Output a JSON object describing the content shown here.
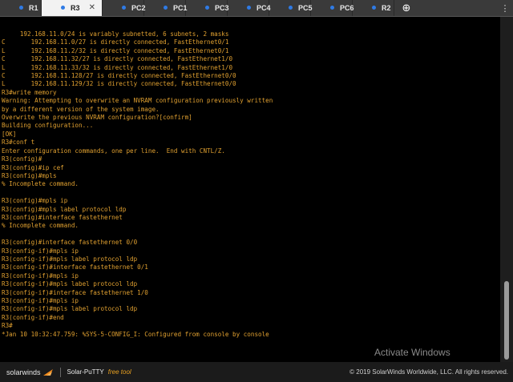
{
  "tabs": [
    {
      "label": "R1",
      "active": false
    },
    {
      "label": "R3",
      "active": true
    },
    {
      "label": "PC2",
      "active": false
    },
    {
      "label": "PC1",
      "active": false
    },
    {
      "label": "PC3",
      "active": false
    },
    {
      "label": "PC4",
      "active": false
    },
    {
      "label": "PC5",
      "active": false
    },
    {
      "label": "PC6",
      "active": false
    },
    {
      "label": "R2",
      "active": false
    }
  ],
  "tab_close_glyph": "✕",
  "new_tab_glyph": "⊕",
  "menu_glyph": "⋮",
  "terminal_lines": [
    "     192.168.11.0/24 is variably subnetted, 6 subnets, 2 masks",
    "C       192.168.11.0/27 is directly connected, FastEthernet0/1",
    "L       192.168.11.2/32 is directly connected, FastEthernet0/1",
    "C       192.168.11.32/27 is directly connected, FastEthernet1/0",
    "L       192.168.11.33/32 is directly connected, FastEthernet1/0",
    "C       192.168.11.128/27 is directly connected, FastEthernet0/0",
    "L       192.168.11.129/32 is directly connected, FastEthernet0/0",
    "R3#write memory",
    "Warning: Attempting to overwrite an NVRAM configuration previously written",
    "by a different version of the system image.",
    "Overwrite the previous NVRAM configuration?[confirm]",
    "Building configuration...",
    "[OK]",
    "R3#conf t",
    "Enter configuration commands, one per line.  End with CNTL/Z.",
    "R3(config)#",
    "R3(config)#ip cef",
    "R3(config)#mpls",
    "% Incomplete command.",
    "",
    "R3(config)#mpls ip",
    "R3(config)#mpls label protocol ldp",
    "R3(config)#interface fastethernet",
    "% Incomplete command.",
    "",
    "R3(config)#interface fastethernet 0/0",
    "R3(config-if)#mpls ip",
    "R3(config-if)#mpls label protocol ldp",
    "R3(config-if)#interface fastethernet 0/1",
    "R3(config-if)#mpls ip",
    "R3(config-if)#mpls label protocol ldp",
    "R3(config-if)#interface fastethernet 1/0",
    "R3(config-if)#mpls ip",
    "R3(config-if)#mpls label protocol ldp",
    "R3(config-if)#end",
    "R3#",
    "*Jan 10 10:32:47.759: %SYS-5-CONFIG_I: Configured from console by console"
  ],
  "watermark": "Activate Windows",
  "footer": {
    "brand": "solarwinds",
    "product": "Solar-PuTTY",
    "free_tool": "free tool",
    "copyright": "© 2019 SolarWinds Worldwide, LLC. All rights reserved."
  },
  "colors": {
    "terminal_text": "#e0a030",
    "terminal_bg": "#000000",
    "tab_dot": "#2f7be5",
    "brand_flame": "#f08a1c"
  }
}
